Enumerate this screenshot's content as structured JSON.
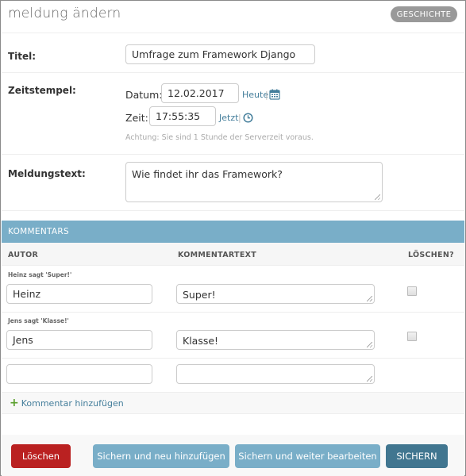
{
  "page": {
    "title": "meldung ändern",
    "history_button": "Geschichte"
  },
  "form": {
    "titel": {
      "label": "Titel:",
      "value": "Umfrage zum Framework Django"
    },
    "zeitstempel": {
      "label": "Zeitstempel:",
      "date_label": "Datum:",
      "date_value": "12.02.2017",
      "today_link": "Heute",
      "time_label": "Zeit:",
      "time_value": "17:55:35",
      "now_link": "Jetzt",
      "separator": "|",
      "timezone_note": "Achtung: Sie sind 1 Stunde der Serverzeit voraus."
    },
    "meldungstext": {
      "label": "Meldungstext:",
      "value": "Wie findet ihr das Framework?"
    }
  },
  "inline": {
    "title": "Kommentars",
    "columns": [
      "Autor",
      "Kommentartext",
      "Löschen?"
    ],
    "rows": [
      {
        "original": "Heinz sagt 'Super!'",
        "autor": "Heinz",
        "text": "Super!",
        "delete": false
      },
      {
        "original": "Jens sagt 'Klasse!'",
        "autor": "Jens",
        "text": "Klasse!",
        "delete": false
      },
      {
        "original": "",
        "autor": "",
        "text": ""
      }
    ],
    "add_link": "Kommentar hinzufügen"
  },
  "actions": {
    "delete": "Löschen",
    "save_add": "Sichern und neu hinzufügen",
    "save_continue": "Sichern und weiter bearbeiten",
    "save": "Sichern"
  },
  "colors": {
    "inline_header": "#79aec8",
    "delete_button": "#ba2121",
    "secondary_button": "#79aec8",
    "primary_button": "#417690",
    "link": "#447e9b"
  },
  "icons": [
    "calendar-icon",
    "clock-icon",
    "plus-icon",
    "resize-grip-icon"
  ]
}
